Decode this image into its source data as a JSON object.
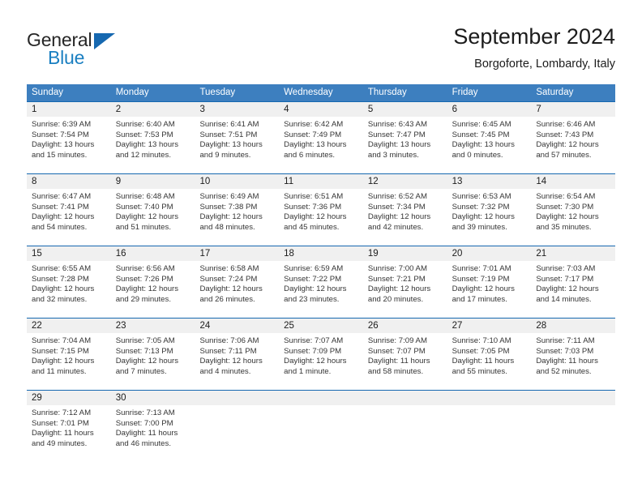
{
  "brand": {
    "word_one": "General",
    "word_two": "Blue",
    "icon": "triangle-logo"
  },
  "header": {
    "title": "September 2024",
    "subtitle": "Borgoforte, Lombardy, Italy"
  },
  "colors": {
    "header_blue": "#3d7fbf",
    "row_border_blue": "#1668b0",
    "daynum_band": "#f0f0f0",
    "brand_blue": "#1a7fc1",
    "text": "#1c1c1c"
  },
  "weekdays": [
    "Sunday",
    "Monday",
    "Tuesday",
    "Wednesday",
    "Thursday",
    "Friday",
    "Saturday"
  ],
  "weeks": [
    [
      {
        "day": "1",
        "sunrise": "Sunrise: 6:39 AM",
        "sunset": "Sunset: 7:54 PM",
        "daylight1": "Daylight: 13 hours",
        "daylight2": "and 15 minutes."
      },
      {
        "day": "2",
        "sunrise": "Sunrise: 6:40 AM",
        "sunset": "Sunset: 7:53 PM",
        "daylight1": "Daylight: 13 hours",
        "daylight2": "and 12 minutes."
      },
      {
        "day": "3",
        "sunrise": "Sunrise: 6:41 AM",
        "sunset": "Sunset: 7:51 PM",
        "daylight1": "Daylight: 13 hours",
        "daylight2": "and 9 minutes."
      },
      {
        "day": "4",
        "sunrise": "Sunrise: 6:42 AM",
        "sunset": "Sunset: 7:49 PM",
        "daylight1": "Daylight: 13 hours",
        "daylight2": "and 6 minutes."
      },
      {
        "day": "5",
        "sunrise": "Sunrise: 6:43 AM",
        "sunset": "Sunset: 7:47 PM",
        "daylight1": "Daylight: 13 hours",
        "daylight2": "and 3 minutes."
      },
      {
        "day": "6",
        "sunrise": "Sunrise: 6:45 AM",
        "sunset": "Sunset: 7:45 PM",
        "daylight1": "Daylight: 13 hours",
        "daylight2": "and 0 minutes."
      },
      {
        "day": "7",
        "sunrise": "Sunrise: 6:46 AM",
        "sunset": "Sunset: 7:43 PM",
        "daylight1": "Daylight: 12 hours",
        "daylight2": "and 57 minutes."
      }
    ],
    [
      {
        "day": "8",
        "sunrise": "Sunrise: 6:47 AM",
        "sunset": "Sunset: 7:41 PM",
        "daylight1": "Daylight: 12 hours",
        "daylight2": "and 54 minutes."
      },
      {
        "day": "9",
        "sunrise": "Sunrise: 6:48 AM",
        "sunset": "Sunset: 7:40 PM",
        "daylight1": "Daylight: 12 hours",
        "daylight2": "and 51 minutes."
      },
      {
        "day": "10",
        "sunrise": "Sunrise: 6:49 AM",
        "sunset": "Sunset: 7:38 PM",
        "daylight1": "Daylight: 12 hours",
        "daylight2": "and 48 minutes."
      },
      {
        "day": "11",
        "sunrise": "Sunrise: 6:51 AM",
        "sunset": "Sunset: 7:36 PM",
        "daylight1": "Daylight: 12 hours",
        "daylight2": "and 45 minutes."
      },
      {
        "day": "12",
        "sunrise": "Sunrise: 6:52 AM",
        "sunset": "Sunset: 7:34 PM",
        "daylight1": "Daylight: 12 hours",
        "daylight2": "and 42 minutes."
      },
      {
        "day": "13",
        "sunrise": "Sunrise: 6:53 AM",
        "sunset": "Sunset: 7:32 PM",
        "daylight1": "Daylight: 12 hours",
        "daylight2": "and 39 minutes."
      },
      {
        "day": "14",
        "sunrise": "Sunrise: 6:54 AM",
        "sunset": "Sunset: 7:30 PM",
        "daylight1": "Daylight: 12 hours",
        "daylight2": "and 35 minutes."
      }
    ],
    [
      {
        "day": "15",
        "sunrise": "Sunrise: 6:55 AM",
        "sunset": "Sunset: 7:28 PM",
        "daylight1": "Daylight: 12 hours",
        "daylight2": "and 32 minutes."
      },
      {
        "day": "16",
        "sunrise": "Sunrise: 6:56 AM",
        "sunset": "Sunset: 7:26 PM",
        "daylight1": "Daylight: 12 hours",
        "daylight2": "and 29 minutes."
      },
      {
        "day": "17",
        "sunrise": "Sunrise: 6:58 AM",
        "sunset": "Sunset: 7:24 PM",
        "daylight1": "Daylight: 12 hours",
        "daylight2": "and 26 minutes."
      },
      {
        "day": "18",
        "sunrise": "Sunrise: 6:59 AM",
        "sunset": "Sunset: 7:22 PM",
        "daylight1": "Daylight: 12 hours",
        "daylight2": "and 23 minutes."
      },
      {
        "day": "19",
        "sunrise": "Sunrise: 7:00 AM",
        "sunset": "Sunset: 7:21 PM",
        "daylight1": "Daylight: 12 hours",
        "daylight2": "and 20 minutes."
      },
      {
        "day": "20",
        "sunrise": "Sunrise: 7:01 AM",
        "sunset": "Sunset: 7:19 PM",
        "daylight1": "Daylight: 12 hours",
        "daylight2": "and 17 minutes."
      },
      {
        "day": "21",
        "sunrise": "Sunrise: 7:03 AM",
        "sunset": "Sunset: 7:17 PM",
        "daylight1": "Daylight: 12 hours",
        "daylight2": "and 14 minutes."
      }
    ],
    [
      {
        "day": "22",
        "sunrise": "Sunrise: 7:04 AM",
        "sunset": "Sunset: 7:15 PM",
        "daylight1": "Daylight: 12 hours",
        "daylight2": "and 11 minutes."
      },
      {
        "day": "23",
        "sunrise": "Sunrise: 7:05 AM",
        "sunset": "Sunset: 7:13 PM",
        "daylight1": "Daylight: 12 hours",
        "daylight2": "and 7 minutes."
      },
      {
        "day": "24",
        "sunrise": "Sunrise: 7:06 AM",
        "sunset": "Sunset: 7:11 PM",
        "daylight1": "Daylight: 12 hours",
        "daylight2": "and 4 minutes."
      },
      {
        "day": "25",
        "sunrise": "Sunrise: 7:07 AM",
        "sunset": "Sunset: 7:09 PM",
        "daylight1": "Daylight: 12 hours",
        "daylight2": "and 1 minute."
      },
      {
        "day": "26",
        "sunrise": "Sunrise: 7:09 AM",
        "sunset": "Sunset: 7:07 PM",
        "daylight1": "Daylight: 11 hours",
        "daylight2": "and 58 minutes."
      },
      {
        "day": "27",
        "sunrise": "Sunrise: 7:10 AM",
        "sunset": "Sunset: 7:05 PM",
        "daylight1": "Daylight: 11 hours",
        "daylight2": "and 55 minutes."
      },
      {
        "day": "28",
        "sunrise": "Sunrise: 7:11 AM",
        "sunset": "Sunset: 7:03 PM",
        "daylight1": "Daylight: 11 hours",
        "daylight2": "and 52 minutes."
      }
    ],
    [
      {
        "day": "29",
        "sunrise": "Sunrise: 7:12 AM",
        "sunset": "Sunset: 7:01 PM",
        "daylight1": "Daylight: 11 hours",
        "daylight2": "and 49 minutes."
      },
      {
        "day": "30",
        "sunrise": "Sunrise: 7:13 AM",
        "sunset": "Sunset: 7:00 PM",
        "daylight1": "Daylight: 11 hours",
        "daylight2": "and 46 minutes."
      },
      {
        "day": "",
        "sunrise": "",
        "sunset": "",
        "daylight1": "",
        "daylight2": ""
      },
      {
        "day": "",
        "sunrise": "",
        "sunset": "",
        "daylight1": "",
        "daylight2": ""
      },
      {
        "day": "",
        "sunrise": "",
        "sunset": "",
        "daylight1": "",
        "daylight2": ""
      },
      {
        "day": "",
        "sunrise": "",
        "sunset": "",
        "daylight1": "",
        "daylight2": ""
      },
      {
        "day": "",
        "sunrise": "",
        "sunset": "",
        "daylight1": "",
        "daylight2": ""
      }
    ]
  ]
}
